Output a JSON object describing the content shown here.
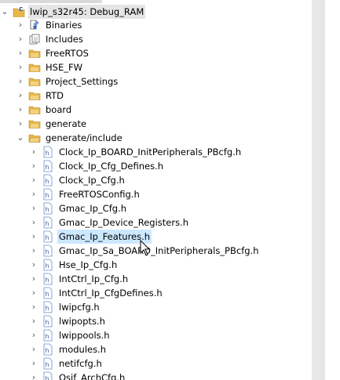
{
  "project": {
    "name": "lwip_s32r45: Debug_RAM"
  },
  "top_items": [
    {
      "label": "Binaries",
      "icon": "binaries-icon"
    },
    {
      "label": "Includes",
      "icon": "includes-icon"
    },
    {
      "label": "FreeRTOS",
      "icon": "folder-icon"
    },
    {
      "label": "HSE_FW",
      "icon": "folder-icon"
    },
    {
      "label": "Project_Settings",
      "icon": "folder-icon"
    },
    {
      "label": "RTD",
      "icon": "folder-icon"
    },
    {
      "label": "board",
      "icon": "folder-icon"
    },
    {
      "label": "generate",
      "icon": "folder-icon"
    },
    {
      "label": "generate/include",
      "icon": "folder-open-icon"
    }
  ],
  "files": [
    "Clock_Ip_BOARD_InitPeripherals_PBcfg.h",
    "Clock_Ip_Cfg_Defines.h",
    "Clock_Ip_Cfg.h",
    "FreeRTOSConfig.h",
    "Gmac_Ip_Cfg.h",
    "Gmac_Ip_Device_Registers.h",
    "Gmac_Ip_Features.h",
    "Gmac_Ip_Sa_BOARD_InitPeripherals_PBcfg.h",
    "Hse_Ip_Cfg.h",
    "IntCtrl_Ip_Cfg.h",
    "IntCtrl_Ip_CfgDefines.h",
    "lwipcfg.h",
    "lwipopts.h",
    "lwippools.h",
    "modules.h",
    "netifcfg.h",
    "Osif_ArchCfg.h"
  ],
  "colors": {
    "folder": "#e8b64a",
    "header_badge": "#6b8dc6",
    "hover": "#cce8ff"
  }
}
